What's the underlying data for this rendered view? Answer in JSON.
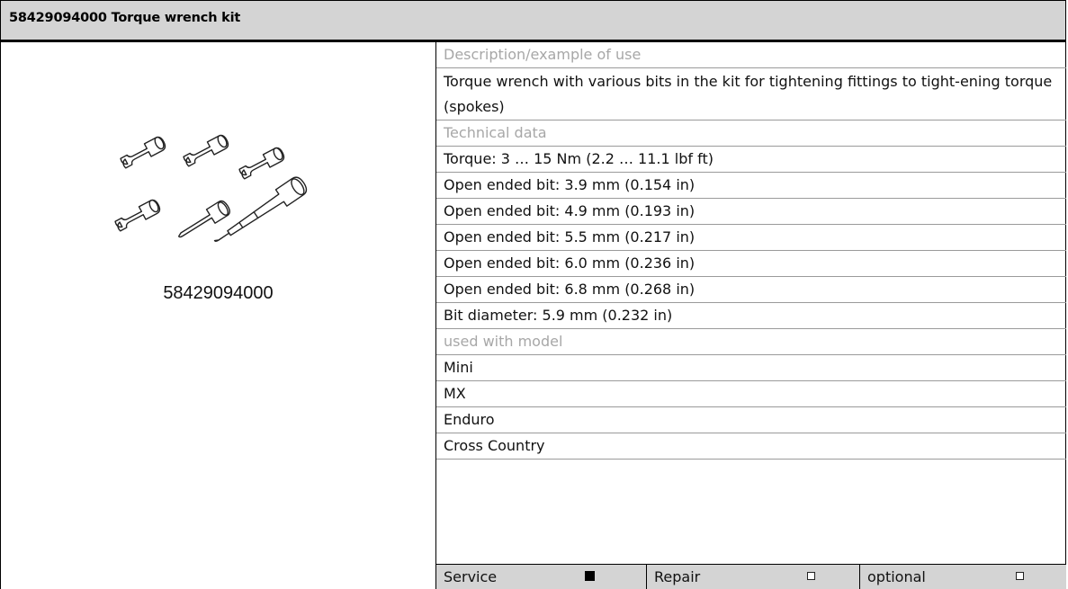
{
  "header": {
    "title": "58429094000 Torque wrench kit"
  },
  "image": {
    "part_number": "58429094000",
    "illustration": "torque-wrench-kit-drawing"
  },
  "description": {
    "heading": "Description/example of use",
    "text": "Torque wrench with various bits in the kit for tightening fittings to tight-ening torque (spokes)"
  },
  "technical": {
    "heading": "Technical data",
    "items": [
      "Torque: 3 … 15 Nm (2.2 … 11.1 lbf ft)",
      "Open ended bit: 3.9 mm (0.154 in)",
      "Open ended bit: 4.9 mm (0.193 in)",
      "Open ended bit: 5.5 mm (0.217 in)",
      "Open ended bit: 6.0 mm (0.236 in)",
      "Open ended bit: 6.8 mm (0.268 in)",
      "Bit diameter: 5.9 mm (0.232 in)"
    ]
  },
  "models": {
    "heading": "used with model",
    "items": [
      "Mini",
      "MX",
      "Enduro",
      "Cross Country"
    ]
  },
  "status": [
    {
      "label": "Service",
      "checked": true
    },
    {
      "label": "Repair",
      "checked": false
    },
    {
      "label": "optional",
      "checked": false
    }
  ]
}
